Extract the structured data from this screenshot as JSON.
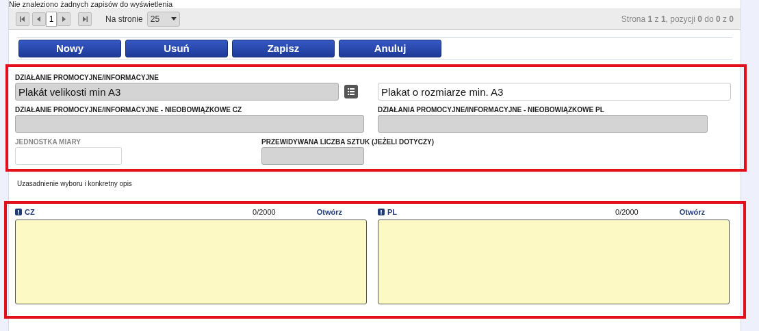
{
  "top_message": "Nie znaleziono żadnych zapisów do wyświetlenia",
  "pager": {
    "page": "1",
    "per_page_label": "Na stronie",
    "per_page": "25",
    "summary": "Strona **1** z **1**, pozycji **0** do **0** z **0**"
  },
  "buttons": [
    "Nowy",
    "Usuń",
    "Zapisz",
    "Anuluj"
  ],
  "fields": [
    {
      "label": "DZIAŁANIE PROMOCYJNE/INFORMACYJNE",
      "value": "Plakát velikosti min A3",
      "disabled": false,
      "readonly": true
    },
    {
      "value": "Plakat o rozmiarze min. A3",
      "disabled": false,
      "readonly": false
    },
    {
      "label": "DZIAŁANIE PROMOCYJNE/INFORMACYJNE - NIEOBOWIĄZKOWE CZ",
      "disabled": false,
      "readonly": true
    },
    {
      "label": "DZIAŁANIA PROMOCYJNE/INFORMACYJNE - NIEOBOWIĄZKOWE PL",
      "disabled": false,
      "readonly": true
    },
    {
      "label": "JEDNOSTKA MIARY",
      "disabled": true,
      "readonly": false
    },
    {
      "label": "PRZEWIDYWANA LICZBA SZTUK (JEŻELI DOTYCZY)",
      "disabled": false,
      "readonly": true
    }
  ],
  "section_title": "Uzasadnienie wyboru i konkretny opis",
  "texts": [
    {
      "lang": "CZ",
      "count": "0/2000",
      "open": "Otwórz"
    },
    {
      "lang": "PL",
      "count": "0/2000",
      "open": "Otwórz"
    }
  ]
}
